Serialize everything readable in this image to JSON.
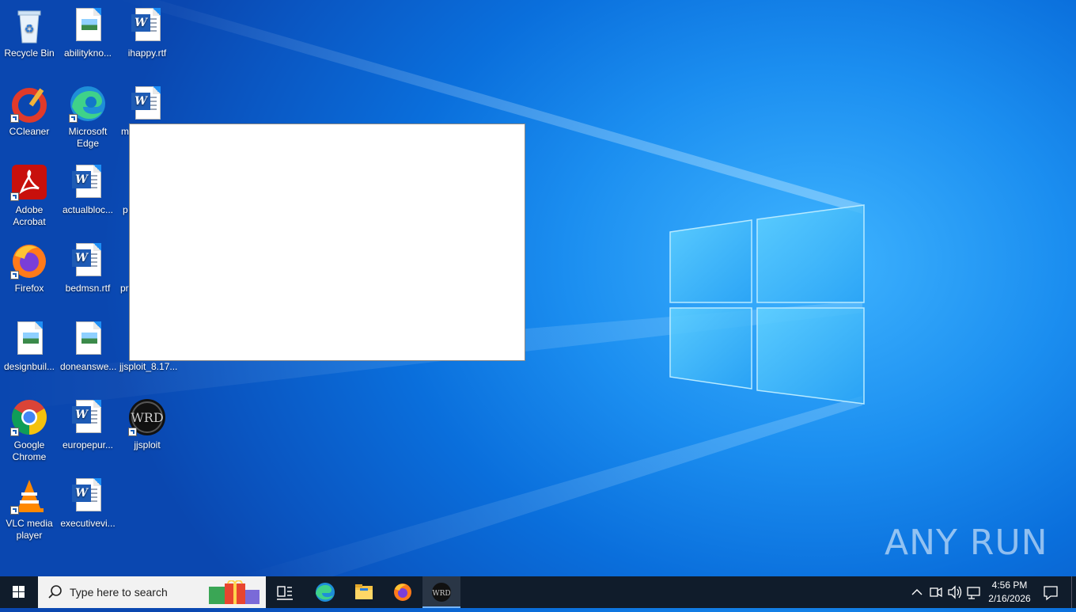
{
  "desktop": {
    "icons": [
      {
        "id": "recycle-bin",
        "label": "Recycle Bin"
      },
      {
        "id": "abilityknow",
        "label": "abilitykno..."
      },
      {
        "id": "ihappy",
        "label": "ihappy.rtf"
      },
      {
        "id": "ccleaner",
        "label": "CCleaner"
      },
      {
        "id": "edge",
        "label": "Microsoft Edge"
      },
      {
        "id": "m-file",
        "label": "m"
      },
      {
        "id": "acrobat",
        "label": "Adobe Acrobat"
      },
      {
        "id": "actualbloc",
        "label": "actualbloc..."
      },
      {
        "id": "p-file",
        "label": "p"
      },
      {
        "id": "firefox",
        "label": "Firefox"
      },
      {
        "id": "bedmsn",
        "label": "bedmsn.rtf"
      },
      {
        "id": "pr-file",
        "label": "pr"
      },
      {
        "id": "designbuil",
        "label": "designbuil..."
      },
      {
        "id": "doneanswe",
        "label": "doneanswe..."
      },
      {
        "id": "jjsploit-zip",
        "label": "jjsploit_8.17..."
      },
      {
        "id": "chrome",
        "label": "Google Chrome"
      },
      {
        "id": "europepur",
        "label": "europepur..."
      },
      {
        "id": "jjsploit",
        "label": "jjsploit"
      },
      {
        "id": "vlc",
        "label": "VLC media player"
      },
      {
        "id": "executivevi",
        "label": "executivevi..."
      }
    ]
  },
  "watermark": "ANY RUN",
  "taskbar": {
    "search_placeholder": "Type here to search",
    "time": "4:56 PM",
    "date": "2/16/2026"
  }
}
